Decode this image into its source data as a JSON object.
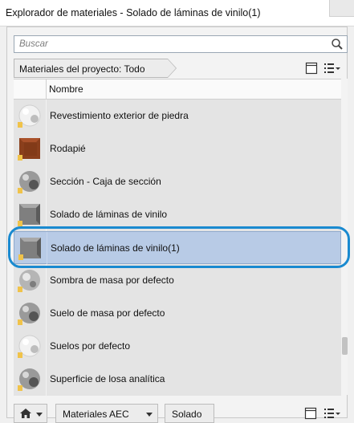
{
  "window": {
    "title": "Explorador de materiales - Solado de láminas de vinilo(1)"
  },
  "search": {
    "placeholder": "Buscar",
    "icon": "search-icon"
  },
  "filter": {
    "label": "Materiales del proyecto: Todo"
  },
  "table": {
    "header": "Nombre",
    "rows": [
      {
        "name": "Revestimiento exterior de piedra",
        "thumb": "sphere-white",
        "selected": false
      },
      {
        "name": "Rodapié",
        "thumb": "cube-wood",
        "selected": false
      },
      {
        "name": "Sección - Caja de sección",
        "thumb": "sphere-gray",
        "selected": false
      },
      {
        "name": "Solado de láminas de vinilo",
        "thumb": "cube-gray",
        "selected": false
      },
      {
        "name": "Solado de láminas de vinilo(1)",
        "thumb": "cube-gray",
        "selected": true
      },
      {
        "name": "Sombra de masa por defecto",
        "thumb": "sphere-glass",
        "selected": false
      },
      {
        "name": "Suelo de masa por defecto",
        "thumb": "sphere-gray",
        "selected": false
      },
      {
        "name": "Suelos por defecto",
        "thumb": "sphere-white",
        "selected": false
      },
      {
        "name": "Superficie de losa analítica",
        "thumb": "sphere-gray",
        "selected": false
      }
    ]
  },
  "breadcrumb": {
    "home_icon": "home-icon",
    "items": [
      "Materiales AEC",
      "Solado"
    ]
  },
  "colors": {
    "selection": "#b8cbe6",
    "highlight_ring": "#1a8ad0"
  }
}
